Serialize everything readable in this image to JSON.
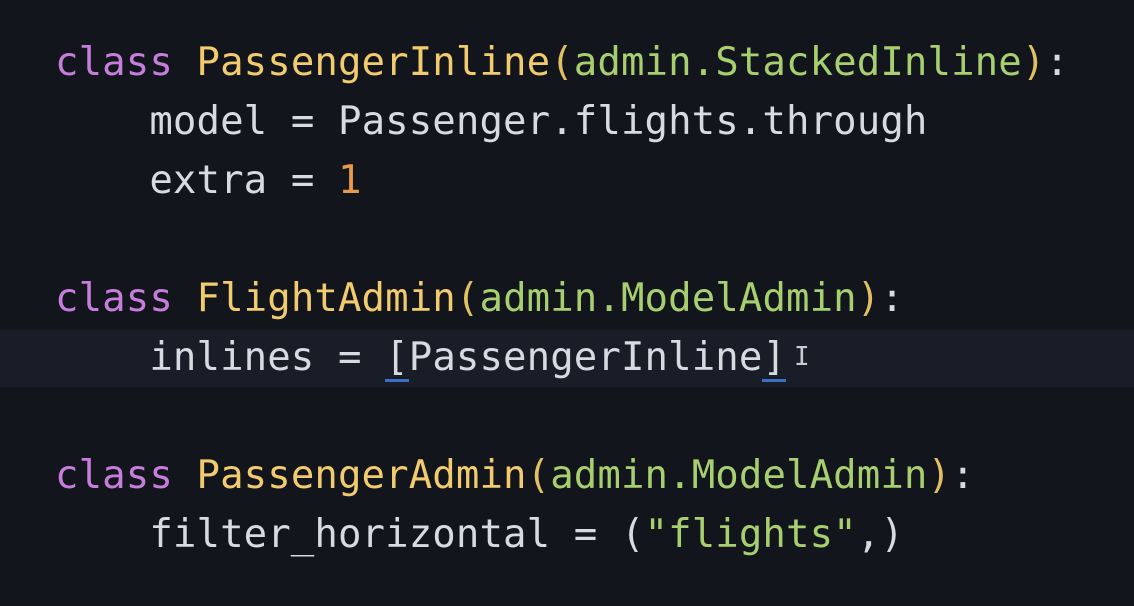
{
  "editor": {
    "lines": [
      {
        "kw": "class",
        "name": "PassengerInline",
        "base": "admin.StackedInline"
      },
      {
        "attr": "model",
        "value": "Passenger.flights.through"
      },
      {
        "attr": "extra",
        "num": "1"
      },
      {
        "kw": "class",
        "name": "FlightAdmin",
        "base": "admin.ModelAdmin"
      },
      {
        "attr": "inlines",
        "value": "PassengerInline"
      },
      {
        "kw": "class",
        "name": "PassengerAdmin",
        "base": "admin.ModelAdmin"
      },
      {
        "attr": "filter_horizontal",
        "str": "\"flights\""
      }
    ]
  },
  "colors": {
    "background": "#12151c",
    "keyword": "#c77ddb",
    "class_name": "#f1cb6e",
    "base": "#a7cf6f",
    "number": "#e89a4c",
    "bracket_match": "#3a6fc4"
  }
}
